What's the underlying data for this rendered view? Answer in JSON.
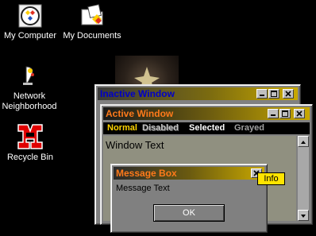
{
  "desktop": {
    "icons": [
      {
        "label": "My Computer",
        "icon": "my-computer-icon"
      },
      {
        "label": "My Documents",
        "icon": "my-documents-icon"
      },
      {
        "label_line1": "Network",
        "label_line2": "Neighborhood",
        "icon": "network-neighborhood-icon"
      },
      {
        "label": "Recycle Bin",
        "icon": "recycle-bin-icon"
      }
    ]
  },
  "inactive_window": {
    "title": "Inactive Window"
  },
  "active_window": {
    "title": "Active Window",
    "menu": {
      "normal": "Normal",
      "disabled": "Disabled",
      "selected": "Selected",
      "grayed": "Grayed"
    },
    "body_text": "Window Text"
  },
  "message_box": {
    "title": "Message Box",
    "text": "Message Text",
    "ok_label": "OK"
  },
  "tooltip": {
    "text": "Info"
  },
  "colors": {
    "desktop_bg": "#000000",
    "inactive_title_text": "#0000c8",
    "active_title_text": "#ff7a1a",
    "title_gradient_end": "#c8a800",
    "menu_normal": "#ffd400",
    "menu_disabled": "#c0c0c0",
    "menu_selected": "#ffffff",
    "menu_grayed": "#a0a0a0",
    "tooltip_bg": "#ffe400"
  }
}
